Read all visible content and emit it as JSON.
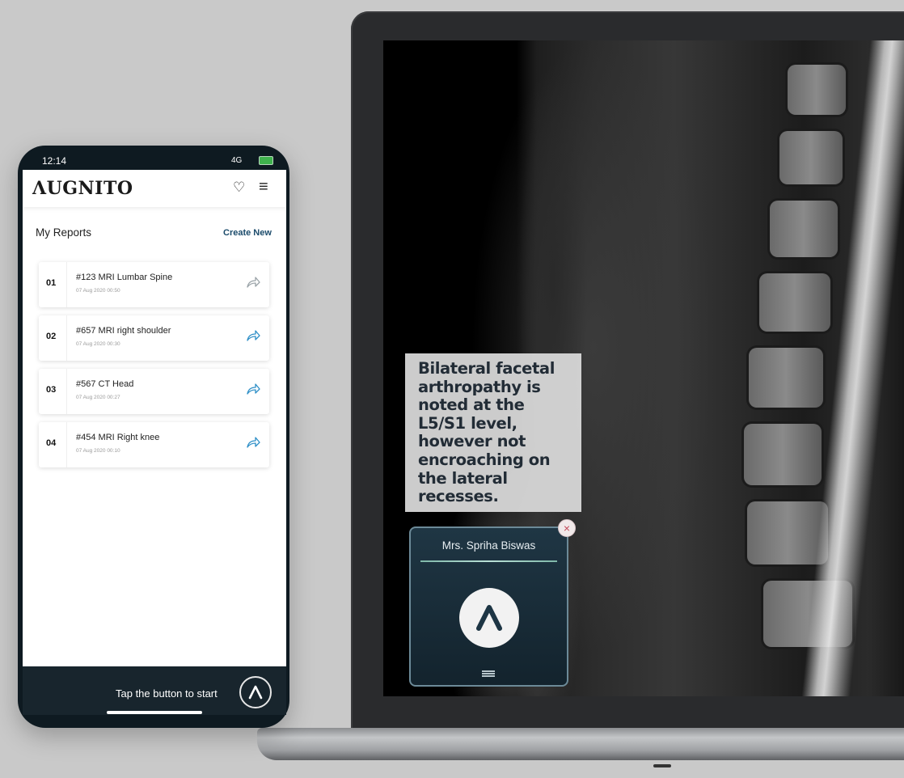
{
  "laptop": {
    "caption_text": "Bilateral facetal arthropathy is noted at the L5/S1 level, however not encroaching on the lateral recesses.",
    "widget_name": "Mrs. Spriha Biswas",
    "close_glyph": "×"
  },
  "phone": {
    "status_time": "12:14",
    "status_network": "4G",
    "brand": "ΛUGNITO",
    "heart_glyph": "♡",
    "menu_glyph": "≡",
    "section_title": "My Reports",
    "create_new": "Create New",
    "reports": [
      {
        "num": "01",
        "title": "#123 MRI Lumbar Spine",
        "date": "07 Aug 2020  00:50"
      },
      {
        "num": "02",
        "title": "#657 MRI right shoulder",
        "date": "07 Aug 2020  00:30"
      },
      {
        "num": "03",
        "title": "#567 CT Head",
        "date": "07 Aug 2020  00:27"
      },
      {
        "num": "04",
        "title": "#454 MRI Right knee",
        "date": "07 Aug 2020  00:10"
      }
    ],
    "bottom_text": "Tap the button to start"
  },
  "colors": {
    "brand_dark": "#18252d",
    "accent_teal": "#7fb8a9",
    "share_grey": "#9aa3a8",
    "share_blue": "#2e8fc7"
  },
  "icons": [
    "heart-icon",
    "menu-icon",
    "share-icon",
    "augnito-logo-icon",
    "close-icon",
    "hamburger-icon"
  ]
}
